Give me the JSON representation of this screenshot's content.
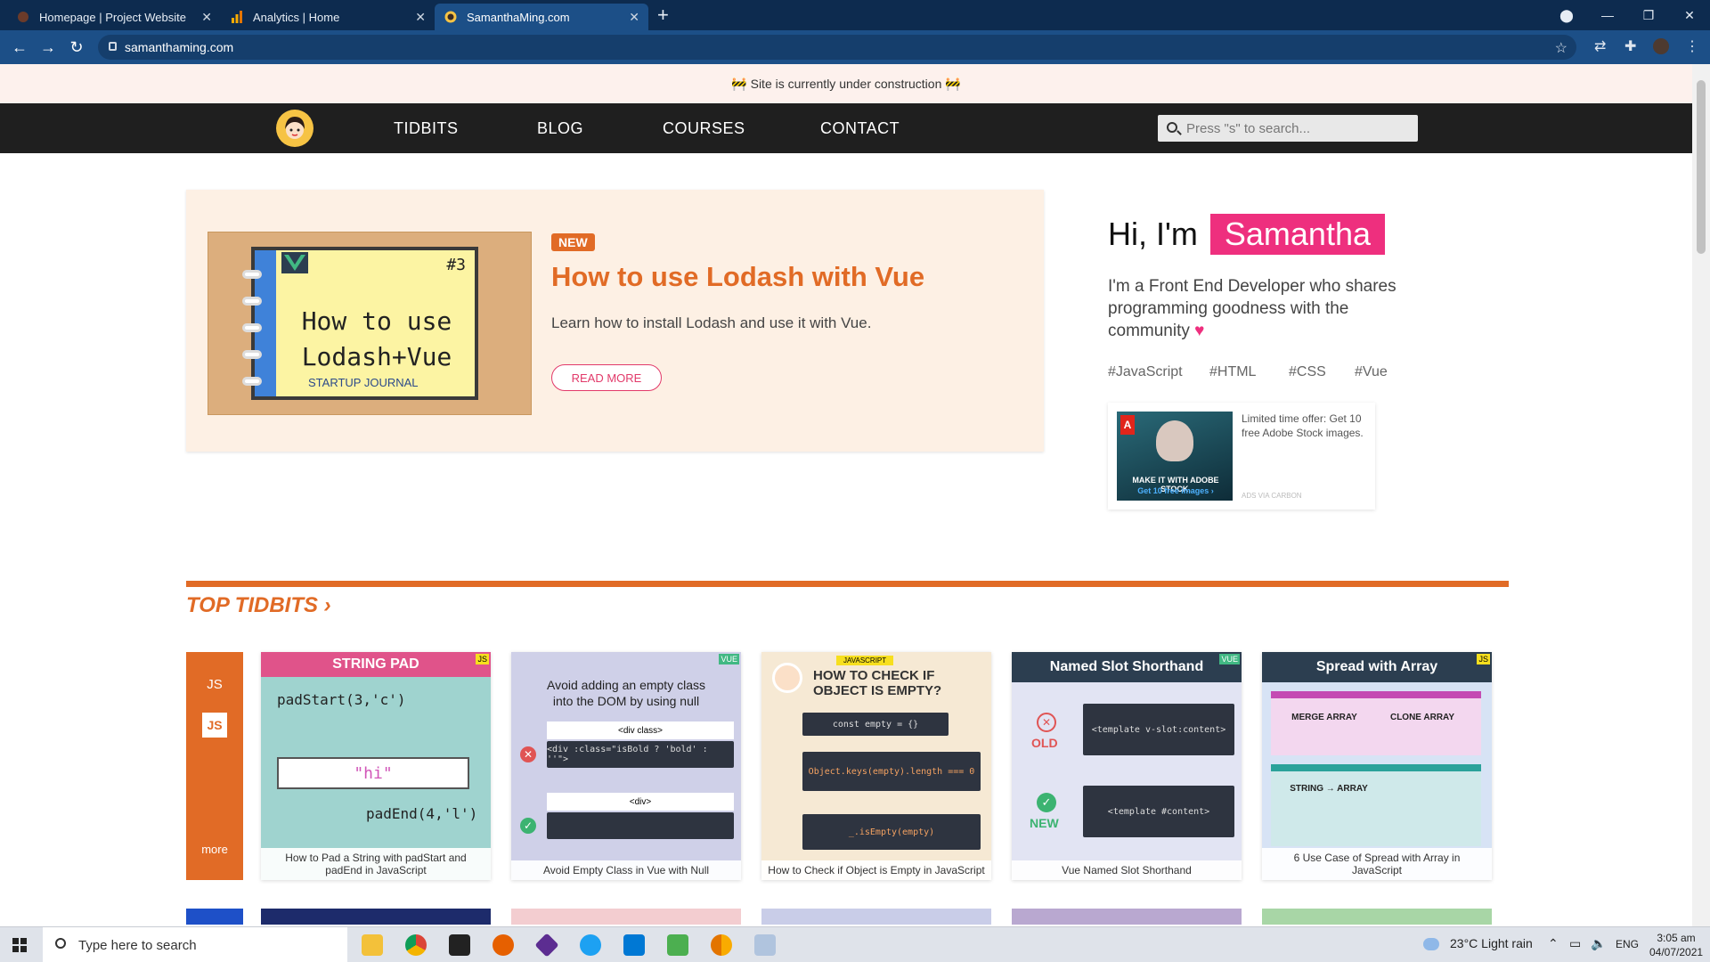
{
  "browser": {
    "tabs": [
      {
        "label": "Homepage | Project Website",
        "icon": "avatar-icon"
      },
      {
        "label": "Analytics | Home",
        "icon": "analytics-icon"
      },
      {
        "label": "SamanthaMing.com",
        "icon": "favicon-icon"
      }
    ],
    "url": "samanthaming.com"
  },
  "banner": "🚧 Site is currently under construction 🚧",
  "nav": {
    "links": [
      "TIDBITS",
      "BLOG",
      "COURSES",
      "CONTACT"
    ],
    "search_placeholder": "Press \"s\" to search..."
  },
  "featured": {
    "badge": "NEW",
    "title": "How to use Lodash with Vue",
    "description": "Learn how to install Lodash and use it with Vue.",
    "button": "READ MORE",
    "image_text": "How to use Lodash+Vue",
    "image_number": "#3",
    "image_footer": "STARTUP JOURNAL"
  },
  "intro": {
    "greeting": "Hi, I'm",
    "name": "Samantha",
    "bio": "I'm a Front End Developer who shares programming goodness with the community",
    "tags": [
      "#JavaScript",
      "#HTML",
      "#CSS",
      "#Vue"
    ]
  },
  "ad": {
    "text": "Limited time offer: Get 10 free Adobe Stock images.",
    "via": "ADS VIA CARBON",
    "image_line1": "MAKE IT WITH ADOBE STOCK.",
    "image_line2": "Get 10 free images ›"
  },
  "top_tidbits": {
    "title": "TOP TIDBITS ›",
    "category": "JS",
    "category_badge": "JS",
    "more": "more",
    "cards": [
      {
        "header": "STRING PAD",
        "caption": "How to Pad a String with padStart and padEnd in JavaScript",
        "lang": "JS",
        "code1": "padStart(3,'c')",
        "code2": "\"hi\"",
        "code3": "padEnd(4,'l')"
      },
      {
        "header": "Avoid adding an empty class into the DOM by using null",
        "caption": "Avoid Empty Class in Vue with Null",
        "lang": "VUE",
        "code1": "<div class>",
        "code2": "<div :class=\"isBold ? 'bold' : ''\">",
        "code3": "<div>"
      },
      {
        "header": "HOW TO CHECK IF OBJECT IS EMPTY?",
        "caption": "How to Check if Object is Empty in JavaScript",
        "lang": "JAVASCRIPT",
        "code1": "const empty = {}",
        "code2": "Object.keys(empty).length === 0",
        "code3": "_.isEmpty(empty)"
      },
      {
        "header": "Named Slot Shorthand",
        "caption": "Vue Named Slot Shorthand",
        "lang": "VUE",
        "code1": "<template v-slot:content>",
        "code2": "<template #content>",
        "old": "OLD",
        "new": "NEW"
      },
      {
        "header": "Spread with Array",
        "caption": "6 Use Case of Spread with Array in JavaScript",
        "lang": "JS",
        "code1": "MERGE ARRAY",
        "code2": "CLONE ARRAY",
        "code3": "STRING → ARRAY"
      }
    ]
  },
  "taskbar": {
    "search_placeholder": "Type here to search",
    "weather": "23°C  Light rain",
    "lang": "ENG",
    "time": "3:05 am",
    "date": "04/07/2021"
  }
}
